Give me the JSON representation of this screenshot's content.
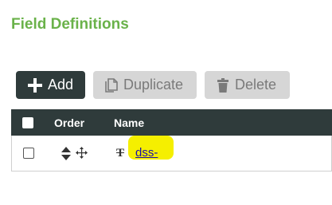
{
  "page": {
    "title": "Field Definitions"
  },
  "toolbar": {
    "add_label": "Add",
    "duplicate_label": "Duplicate",
    "delete_label": "Delete"
  },
  "table": {
    "columns": {
      "order": "Order",
      "name": "Name"
    },
    "rows": [
      {
        "type_icon": "T",
        "name": "dss-"
      }
    ]
  },
  "colors": {
    "title_green": "#6ab24a",
    "dark_header": "#2f3b3b",
    "disabled_button": "#d6d6d6",
    "highlight_yellow": "#f5ef00",
    "link_blue": "#1a0dab"
  },
  "icons": {
    "add": "plus-icon",
    "duplicate": "copy-icon",
    "delete": "trash-icon",
    "sort": "sort-icon",
    "move": "move-icon",
    "text_type": "text-type-icon"
  }
}
